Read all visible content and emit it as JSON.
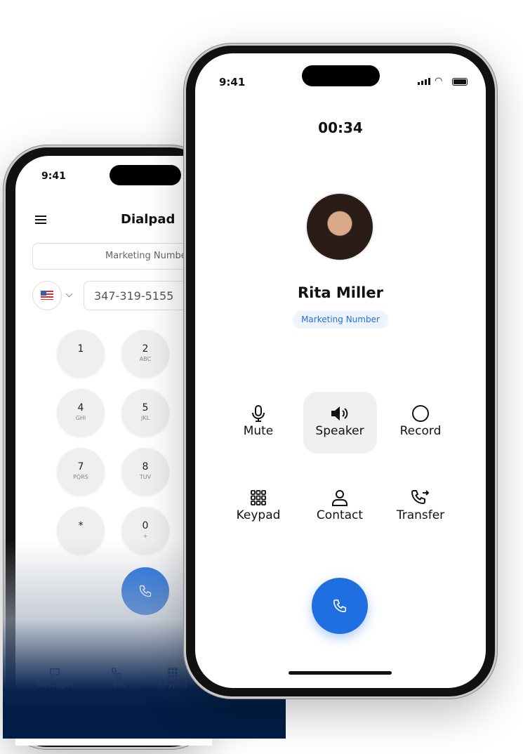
{
  "back_phone": {
    "status_time": "9:41",
    "title": "Dialpad",
    "caller_id_placeholder": "Marketing Number",
    "country_flag": "us-flag-icon",
    "phone_number": "347-319-5155",
    "keys": [
      {
        "digit": "1",
        "letters": ""
      },
      {
        "digit": "2",
        "letters": "ABC"
      },
      {
        "digit": "4",
        "letters": "GHI"
      },
      {
        "digit": "5",
        "letters": "JKL"
      },
      {
        "digit": "7",
        "letters": "PQRS"
      },
      {
        "digit": "8",
        "letters": "TUV"
      },
      {
        "digit": "*",
        "letters": ""
      },
      {
        "digit": "0",
        "letters": "+"
      }
    ],
    "nav": [
      {
        "label": "Messages",
        "icon": "message-icon"
      },
      {
        "label": "Calls",
        "icon": "phone-icon"
      },
      {
        "label": "Keypad",
        "icon": "keypad-icon"
      }
    ]
  },
  "front_phone": {
    "status_time": "9:41",
    "call_timer": "00:34",
    "contact_name": "Rita Miller",
    "line_badge": "Marketing Number",
    "controls": [
      {
        "label": "Mute",
        "icon": "microphone-icon"
      },
      {
        "label": "Speaker",
        "icon": "speaker-icon",
        "active": true
      },
      {
        "label": "Record",
        "icon": "record-icon"
      },
      {
        "label": "Keypad",
        "icon": "keypad-icon"
      },
      {
        "label": "Contact",
        "icon": "contact-icon"
      },
      {
        "label": "Transfer",
        "icon": "transfer-call-icon"
      }
    ]
  },
  "colors": {
    "accent": "#1f6fe0",
    "badge_bg": "#eef4fd",
    "navy": "#021d45"
  }
}
